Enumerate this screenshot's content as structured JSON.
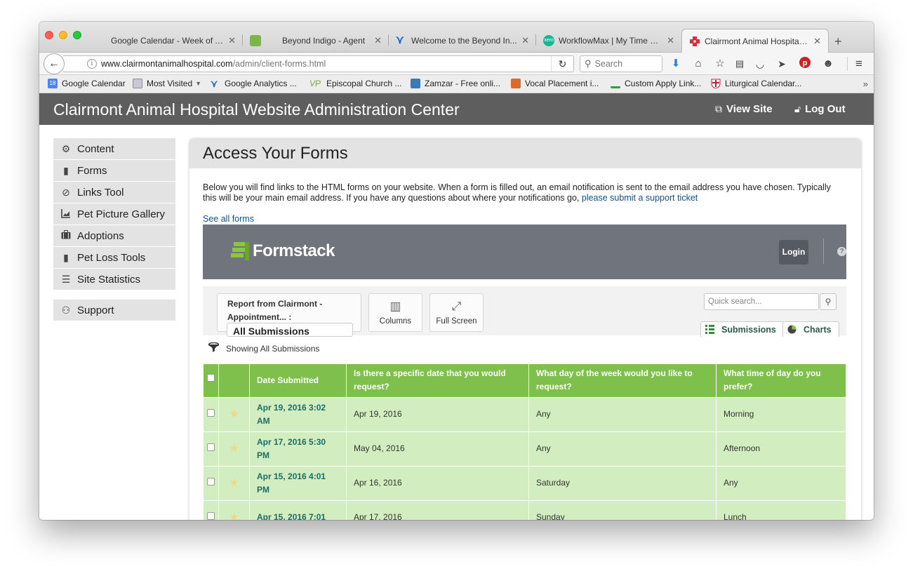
{
  "browser": {
    "tabs": [
      {
        "title": "Google Calendar - Week of Apr ...",
        "icon": "calendar-icon",
        "color": "#4a85f0"
      },
      {
        "title": "Beyond Indigo - Agent",
        "icon": "agent-icon",
        "color": "#7ab648"
      },
      {
        "title": "Welcome to the Beyond In...",
        "icon": "beyond-indigo-icon",
        "color": "#2a6bc4"
      },
      {
        "title": "WorkflowMax | My Time Sh...",
        "icon": "xero-icon",
        "color": "#1ab394"
      },
      {
        "title": "Clairmont Animal Hospital ...",
        "icon": "red-cross-icon",
        "color": "#d9303f"
      }
    ],
    "url_host": "www.clairmontanimalhospital.com",
    "url_path": "/admin/client-forms.html",
    "search_placeholder": "Search",
    "bookmarks": [
      {
        "label": "Google Calendar",
        "icon": "calendar-icon",
        "badge": "18"
      },
      {
        "label": "Most Visited",
        "icon": "folder-icon"
      },
      {
        "label": "Google Analytics ...",
        "icon": "beyond-indigo-icon"
      },
      {
        "label": "Episcopal Church ...",
        "icon": "vp-icon"
      },
      {
        "label": "Zamzar - Free onli...",
        "icon": "zamzar-icon"
      },
      {
        "label": "Vocal Placement i...",
        "icon": "vocal-icon"
      },
      {
        "label": "Custom Apply Link...",
        "icon": "apply-icon"
      },
      {
        "label": "Liturgical Calendar...",
        "icon": "shield-cross-icon"
      }
    ]
  },
  "admin": {
    "title": "Clairmont Animal Hospital Website Administration Center",
    "view_site": "View Site",
    "log_out": "Log Out"
  },
  "sidebar": {
    "items": [
      {
        "label": "Content",
        "icon": "gear-icon"
      },
      {
        "label": "Forms",
        "icon": "bookmark-icon"
      },
      {
        "label": "Links Tool",
        "icon": "link-icon"
      },
      {
        "label": "Pet Picture Gallery",
        "icon": "chart-icon"
      },
      {
        "label": "Adoptions",
        "icon": "briefcase-icon"
      },
      {
        "label": "Pet Loss Tools",
        "icon": "bookmark-icon"
      },
      {
        "label": "Site Statistics",
        "icon": "list-icon"
      }
    ],
    "support": {
      "label": "Support",
      "icon": "support-icon"
    }
  },
  "main": {
    "heading": "Access Your Forms",
    "intro": "Below you will find links to the HTML forms on your website. When a form is filled out, an email notification is sent to the email address you have chosen. Typically this will be your main email address. If you have any questions about where your notifications go, ",
    "support_link": "please submit a support ticket",
    "see_all": "See all forms"
  },
  "formstack": {
    "brand": "Formstack",
    "login": "Login",
    "report_title": "Report from Clairmont - Appointment... :",
    "report_selected": "All Submissions",
    "columns_label": "Columns",
    "fullscreen_label": "Full Screen",
    "quick_search_placeholder": "Quick search...",
    "tab_submissions": "Submissions",
    "tab_charts": "Charts",
    "showing": "Showing All Submissions",
    "columns": [
      "Date Submitted",
      "Is there a specific date that you would request?",
      "What day of the week would you like to request?",
      "What time of day do you prefer?"
    ],
    "rows": [
      {
        "submitted": "Apr 19, 2016 3:02 AM",
        "date": "Apr 19, 2016",
        "day": "Any",
        "time": "Morning"
      },
      {
        "submitted": "Apr 17, 2016 5:30 PM",
        "date": "May 04, 2016",
        "day": "Any",
        "time": "Afternoon"
      },
      {
        "submitted": "Apr 15, 2016 4:01 PM",
        "date": "Apr 16, 2016",
        "day": "Saturday",
        "time": "Any"
      },
      {
        "submitted": "Apr 15, 2016 7:01",
        "date": "Apr 17, 2016",
        "day": "Sunday",
        "time": "Lunch"
      }
    ]
  },
  "colors": {
    "admin_bar": "#5e5e5e",
    "grid_header": "#7ec04b",
    "grid_row": "#d2edbf",
    "link": "#14508c",
    "formstack_bar": "#70747d"
  }
}
